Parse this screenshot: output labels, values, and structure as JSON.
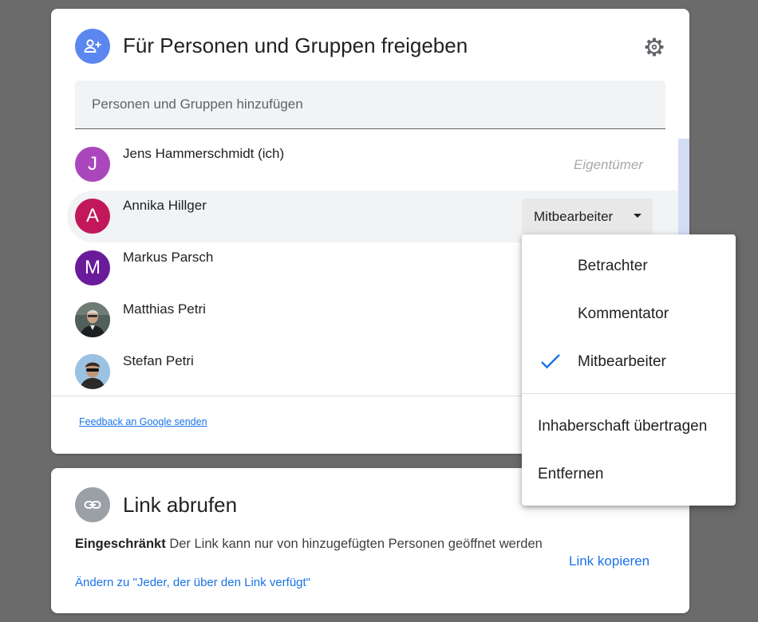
{
  "share": {
    "title": "Für Personen und Gruppen freigeben",
    "add_placeholder": "Personen und Gruppen hinzufügen",
    "people": [
      {
        "initial": "J",
        "name": "Jens Hammerschmidt (ich)",
        "role": "Eigentümer",
        "avatar_color": "#ab47bc"
      },
      {
        "initial": "A",
        "name": "Annika Hillger",
        "role": "Mitbearbeiter",
        "avatar_color": "#c2185b"
      },
      {
        "initial": "M",
        "name": "Markus Parsch",
        "avatar_color": "#6a1b9a"
      },
      {
        "name": "Matthias Petri"
      },
      {
        "name": "Stefan Petri"
      }
    ],
    "feedback": "Feedback an Google senden"
  },
  "role_menu": {
    "items": [
      "Betrachter",
      "Kommentator",
      "Mitbearbeiter"
    ],
    "selected": "Mitbearbeiter",
    "actions": [
      "Inhaberschaft übertragen",
      "Entfernen"
    ]
  },
  "link": {
    "title": "Link abrufen",
    "restriction": "Eingeschränkt",
    "description": "Der Link kann nur von hinzugefügten Personen geöffnet werden",
    "change": "Ändern zu \"Jeder, der über den Link verfügt\"",
    "copy": "Link kopieren"
  },
  "colors": {
    "accent": "#1a73e8",
    "header_icon_blue": "#5c86f0",
    "link_icon_gray": "#9aa0a6",
    "backdrop": "#6b6b6b"
  }
}
